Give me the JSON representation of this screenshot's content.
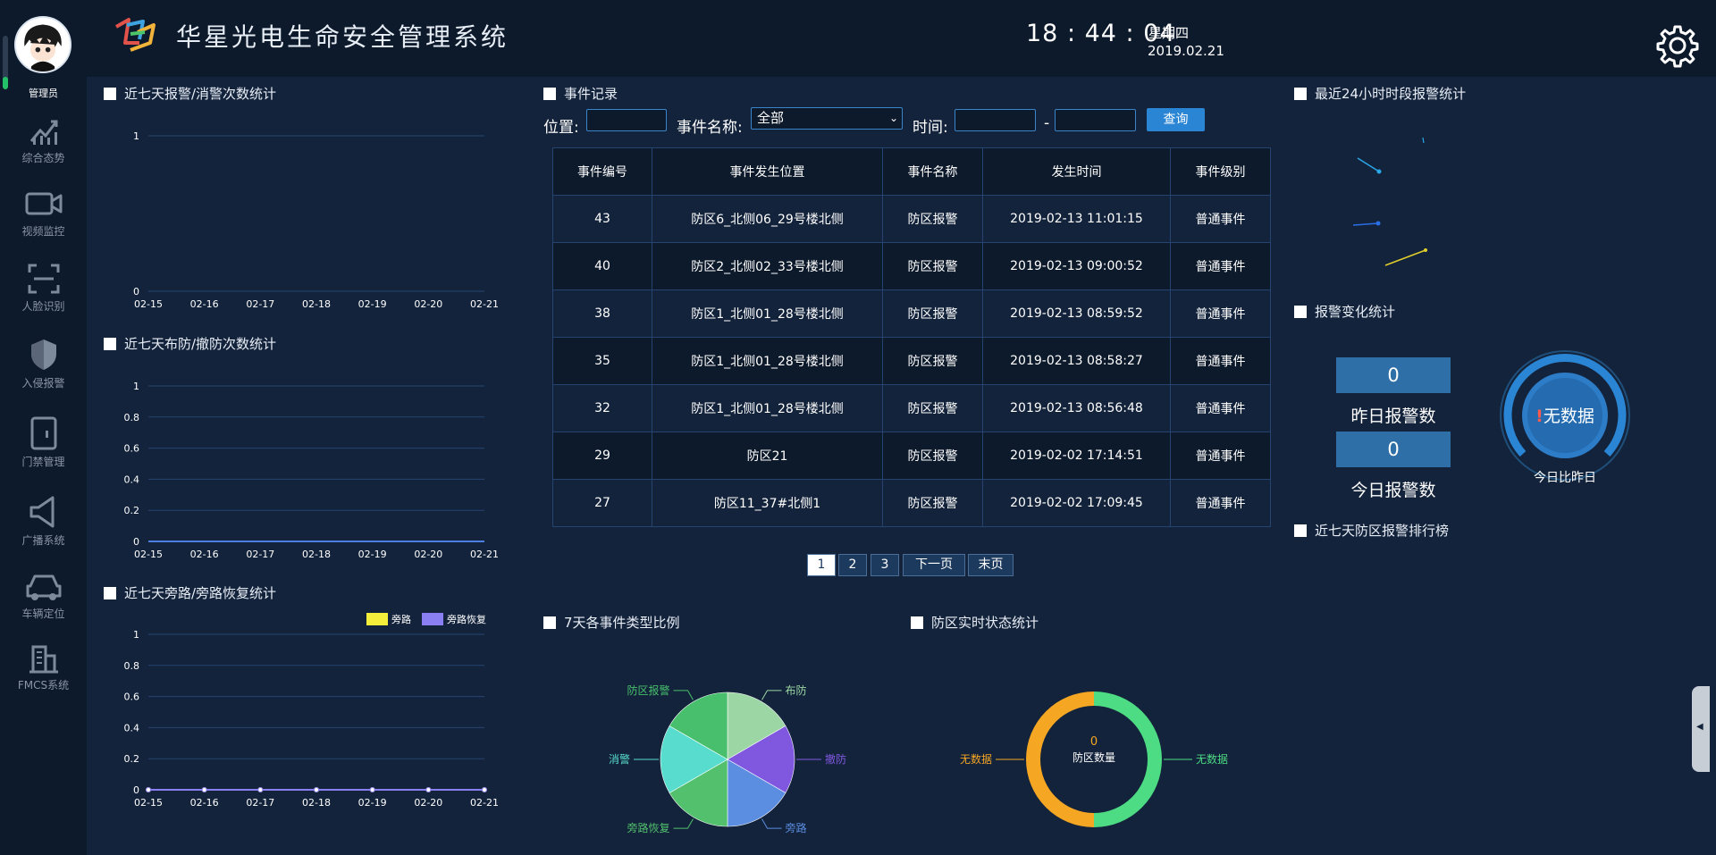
{
  "header": {
    "title": "华星光电生命安全管理系统",
    "time": "18 : 44 : 04",
    "weekday": "星期四",
    "date": "2019.02.21"
  },
  "sidebar": {
    "user_label": "管理员",
    "items": [
      {
        "label": "综合态势",
        "icon": "trend-chart-icon"
      },
      {
        "label": "视频监控",
        "icon": "video-camera-icon"
      },
      {
        "label": "人脸识别",
        "icon": "face-scan-icon"
      },
      {
        "label": "入侵报警",
        "icon": "shield-icon"
      },
      {
        "label": "门禁管理",
        "icon": "door-icon"
      },
      {
        "label": "广播系统",
        "icon": "speaker-icon"
      },
      {
        "label": "车辆定位",
        "icon": "car-icon"
      },
      {
        "label": "FMCS系统",
        "icon": "building-icon"
      }
    ]
  },
  "panels": {
    "alarm7": "近七天报警/消警次数统计",
    "arm7": "近七天布防/撤防次数统计",
    "bypass7": "近七天旁路/旁路恢复统计",
    "events": "事件记录",
    "alarm24": "最近24小时时段报警统计",
    "alarm_change": "报警变化统计",
    "rank7": "近七天防区报警排行榜",
    "type_ratio": "7天各事件类型比例",
    "zone_status": "防区实时状态统计"
  },
  "filters": {
    "location_label": "位置:",
    "location_value": "",
    "event_name_label": "事件名称:",
    "event_name_value": "全部",
    "time_label": "时间:",
    "time_from": "",
    "time_sep": "-",
    "time_to": "",
    "query_label": "查询"
  },
  "table": {
    "headers": [
      "事件编号",
      "事件发生位置",
      "事件名称",
      "发生时间",
      "事件级别"
    ],
    "rows": [
      [
        "43",
        "防区6_北侧06_29号楼北侧",
        "防区报警",
        "2019-02-13 11:01:15",
        "普通事件"
      ],
      [
        "40",
        "防区2_北侧02_33号楼北侧",
        "防区报警",
        "2019-02-13 09:00:52",
        "普通事件"
      ],
      [
        "38",
        "防区1_北侧01_28号楼北侧",
        "防区报警",
        "2019-02-13 08:59:52",
        "普通事件"
      ],
      [
        "35",
        "防区1_北侧01_28号楼北侧",
        "防区报警",
        "2019-02-13 08:58:27",
        "普通事件"
      ],
      [
        "32",
        "防区1_北侧01_28号楼北侧",
        "防区报警",
        "2019-02-13 08:56:48",
        "普通事件"
      ],
      [
        "29",
        "防区21",
        "防区报警",
        "2019-02-02 17:14:51",
        "普通事件"
      ],
      [
        "27",
        "防区11_37#北侧1",
        "防区报警",
        "2019-02-02 17:09:45",
        "普通事件"
      ]
    ]
  },
  "pagination": [
    "1",
    "2",
    "3",
    "下一页",
    "末页"
  ],
  "stats": {
    "yesterday_value": "0",
    "yesterday_label": "昨日报警数",
    "today_value": "0",
    "today_label": "今日报警数",
    "gauge_text": "无数据",
    "gauge_mark": "!",
    "gauge_label": "今日比昨日"
  },
  "colors": {
    "bg": "#13233b",
    "panel_dark": "#0d1a2b",
    "accent": "#2a85d4",
    "grid": "#254470"
  },
  "chart_data": [
    {
      "id": "alarm7",
      "type": "line",
      "x": [
        "02-15",
        "02-16",
        "02-17",
        "02-18",
        "02-19",
        "02-20",
        "02-21"
      ],
      "series": [],
      "yticks": [
        "0",
        "1"
      ],
      "ylim": [
        0,
        1
      ]
    },
    {
      "id": "arm7",
      "type": "line",
      "x": [
        "02-15",
        "02-16",
        "02-17",
        "02-18",
        "02-19",
        "02-20",
        "02-21"
      ],
      "series": [
        {
          "values": [
            0,
            0,
            0,
            0,
            0,
            0,
            0
          ],
          "color": "#4c7fe0"
        }
      ],
      "yticks": [
        "0",
        "0.2",
        "0.4",
        "0.6",
        "0.8",
        "1"
      ],
      "ylim": [
        0,
        1
      ]
    },
    {
      "id": "bypass7",
      "type": "line",
      "x": [
        "02-15",
        "02-16",
        "02-17",
        "02-18",
        "02-19",
        "02-20",
        "02-21"
      ],
      "series": [
        {
          "name": "旁路",
          "values": [
            0,
            0,
            0,
            0,
            0,
            0,
            0
          ],
          "color": "#f5ef3b"
        },
        {
          "name": "旁路恢复",
          "values": [
            0,
            0,
            0,
            0,
            0,
            0,
            0
          ],
          "color": "#8a7ff2"
        }
      ],
      "yticks": [
        "0",
        "0.2",
        "0.4",
        "0.6",
        "0.8",
        "1"
      ],
      "ylim": [
        0,
        1
      ],
      "legend": "top-right"
    },
    {
      "id": "type_ratio",
      "type": "pie",
      "slices": [
        {
          "name": "布防",
          "value": 1,
          "color": "#9bd6a4"
        },
        {
          "name": "撤防",
          "value": 1,
          "color": "#8058e0"
        },
        {
          "name": "旁路",
          "value": 1,
          "color": "#5b8de0"
        },
        {
          "name": "旁路恢复",
          "value": 1,
          "color": "#52c06d"
        },
        {
          "name": "消警",
          "value": 1,
          "color": "#58dccd"
        },
        {
          "name": "防区报警",
          "value": 1,
          "color": "#47bf6c"
        }
      ]
    },
    {
      "id": "zone_status",
      "type": "pie",
      "center_value": "0",
      "center_label": "防区数量",
      "slices": [
        {
          "name": "无数据",
          "value": 1,
          "color": "#4ddc84"
        },
        {
          "name": "无数据",
          "value": 1,
          "color": "#f5a623"
        }
      ]
    }
  ]
}
